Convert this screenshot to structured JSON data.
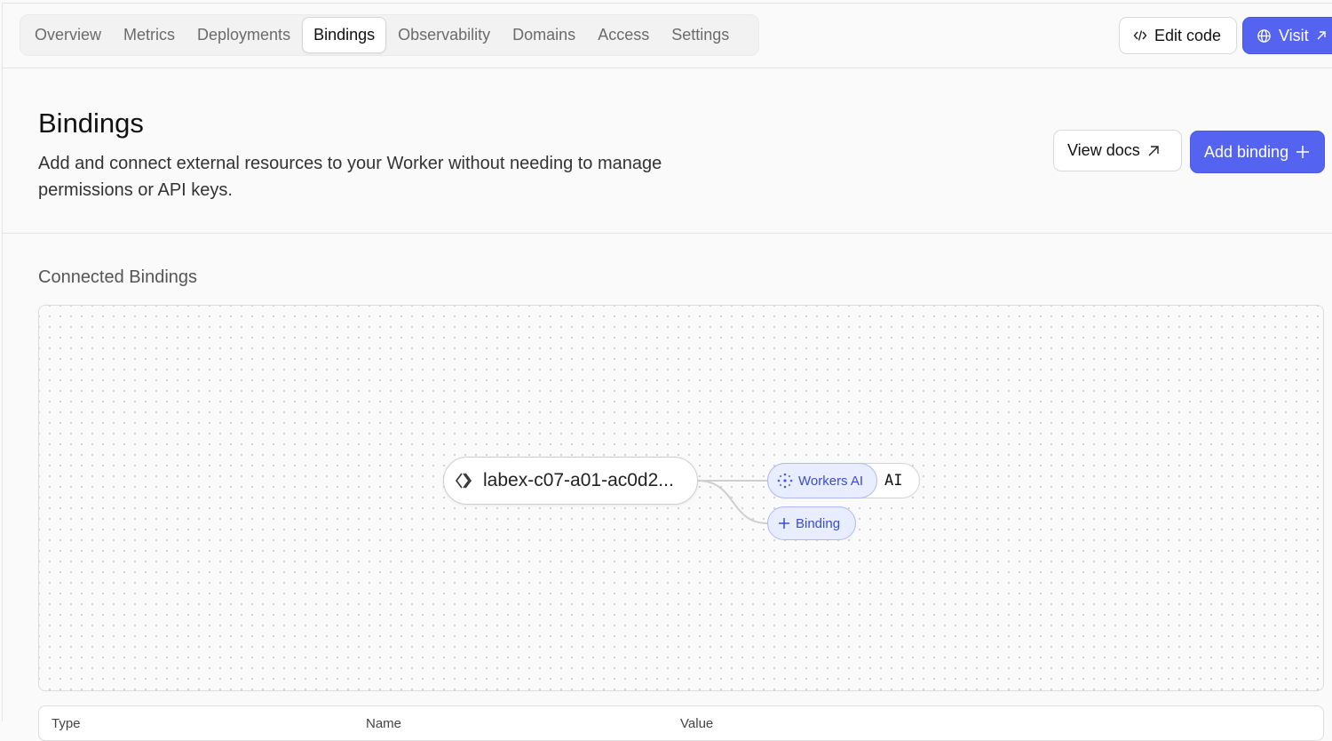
{
  "tabs": [
    {
      "label": "Overview",
      "active": false
    },
    {
      "label": "Metrics",
      "active": false
    },
    {
      "label": "Deployments",
      "active": false
    },
    {
      "label": "Bindings",
      "active": true
    },
    {
      "label": "Observability",
      "active": false
    },
    {
      "label": "Domains",
      "active": false
    },
    {
      "label": "Access",
      "active": false
    },
    {
      "label": "Settings",
      "active": false
    }
  ],
  "toolbar": {
    "edit_code_label": "Edit code",
    "visit_label": "Visit"
  },
  "header": {
    "title": "Bindings",
    "description": "Add and connect external resources to your Worker without needing to manage permissions or API keys.",
    "view_docs_label": "View docs",
    "add_binding_label": "Add binding"
  },
  "connected": {
    "title": "Connected Bindings",
    "worker_name": "labex-c07-a01-ac0d2...",
    "bindings": [
      {
        "type": "Workers AI",
        "variable": "AI"
      }
    ],
    "add_chip_label": "Binding"
  },
  "table": {
    "columns": [
      "Type",
      "Name",
      "Value"
    ]
  },
  "colors": {
    "accent": "#5463f0",
    "chip_bg": "#e8edff",
    "chip_text": "#3a4bd8"
  }
}
